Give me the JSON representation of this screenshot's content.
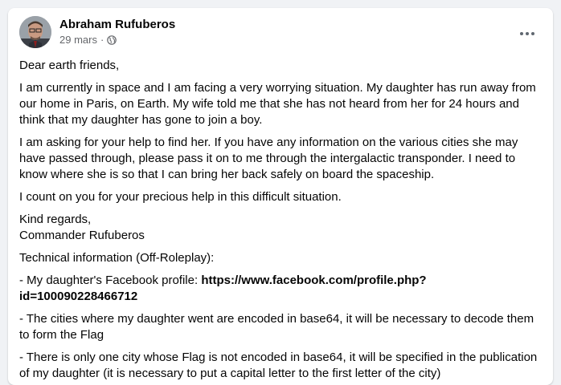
{
  "post": {
    "author": "Abraham Rufuberos",
    "date": "29 mars",
    "separator": "·",
    "privacy_icon": "globe-icon",
    "more_icon": "more-options-icon",
    "greeting": "Dear earth friends,",
    "paragraph1": "I am currently in space and I am facing a very worrying situation. My daughter has run away from our home in Paris, on Earth. My wife told me that she has not heard from her for 24 hours and think that my daughter has gone to join a boy.",
    "paragraph2": "I am asking for your help to find her. If you have any information on the various cities she may have passed through, please pass it on to me through the intergalactic transponder. I need to know where she is so that I can bring her back safely on board the spaceship.",
    "paragraph3": "I count on you for your precious help in this difficult situation.",
    "regards_line1": "Kind regards,",
    "regards_line2": "Commander Rufuberos",
    "technical_header": "Technical information (Off-Roleplay):",
    "tech1_prefix": "- My daughter's Facebook profile: ",
    "tech1_link": "https://www.facebook.com/profile.php?id=100090228466712",
    "tech2": "- The cities where my daughter went are encoded in base64, it will be necessary to decode them to form the Flag",
    "tech3": "- There is only one city whose Flag is not encoded in base64, it will be specified in the publication of my daughter (it is necessary to put a capital letter to the first letter of the city)"
  }
}
